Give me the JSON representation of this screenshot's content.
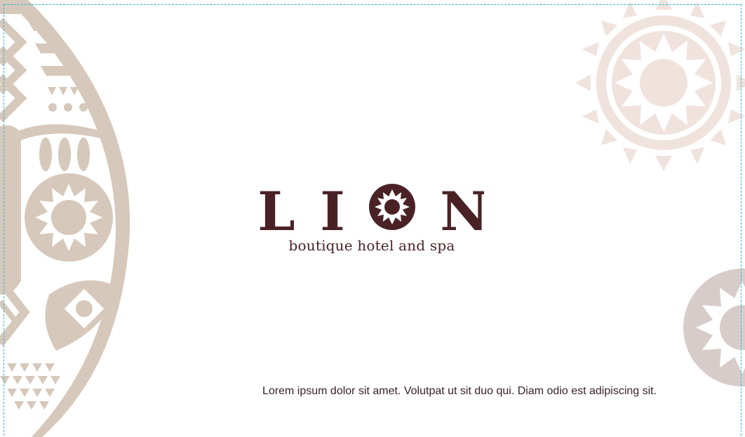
{
  "brand": {
    "name_letters": [
      "L",
      "I",
      "",
      "N"
    ],
    "tagline": "boutique hotel and spa"
  },
  "body_text": "Lorem ipsum dolor sit amet. Volutpat ut sit duo qui. Diam odio est adipiscing sit.",
  "colors": {
    "brand_dark": "#4a2226",
    "tan": "#d6c8ba",
    "light_pink": "#f0e3dd",
    "mauve": "#d8ccca",
    "guide_line": "#29b6d8"
  }
}
